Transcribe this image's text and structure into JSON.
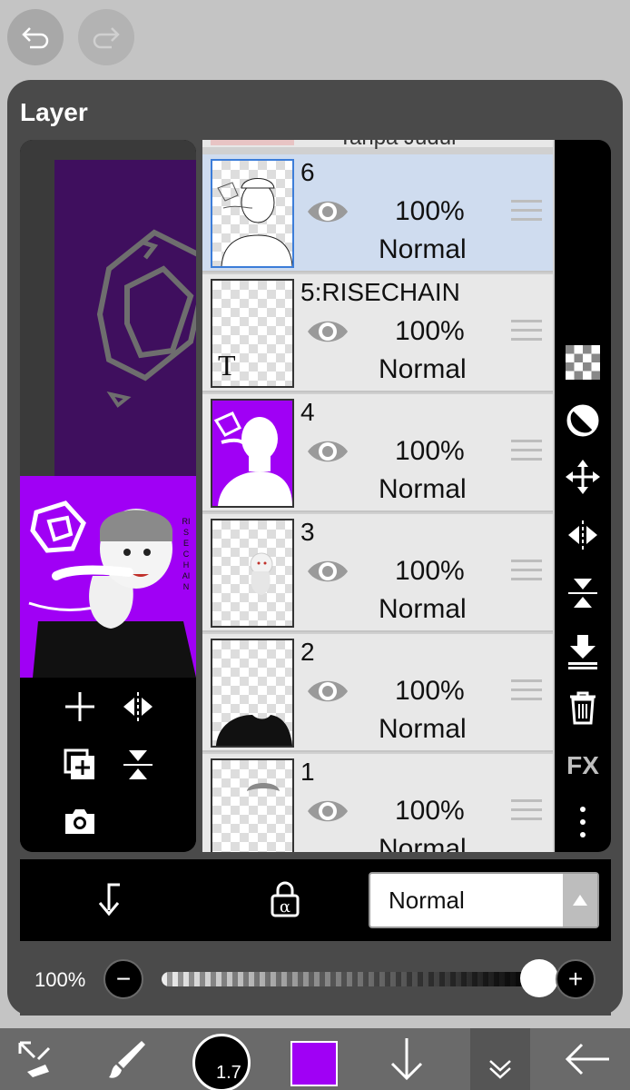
{
  "panel": {
    "title": "Layer"
  },
  "partial_layer_name": "Tanpa Judul",
  "layers": [
    {
      "name": "6",
      "opacity": "100%",
      "blend": "Normal",
      "selected": true
    },
    {
      "name": "5:RISECHAIN",
      "opacity": "100%",
      "blend": "Normal",
      "selected": false
    },
    {
      "name": "4",
      "opacity": "100%",
      "blend": "Normal",
      "selected": false
    },
    {
      "name": "3",
      "opacity": "100%",
      "blend": "Normal",
      "selected": false
    },
    {
      "name": "2",
      "opacity": "100%",
      "blend": "Normal",
      "selected": false
    },
    {
      "name": "1",
      "opacity": "100%",
      "blend": "Normal",
      "selected": false
    }
  ],
  "art_text": "RISECHAIN",
  "text_thumb_glyph": "T",
  "side_tools": [
    "checker-icon",
    "mask-icon",
    "move-icon",
    "flip-h-icon",
    "flip-v-icon",
    "merge-down-icon",
    "trash-icon",
    "fx-label",
    "more-icon"
  ],
  "fx_label": "FX",
  "blend_mode": {
    "value": "Normal"
  },
  "opacity_bar": {
    "label": "100%",
    "minus": "−",
    "plus": "+",
    "value": 1.0
  },
  "bottom": {
    "brush_size": "1.7",
    "color": "#a000f5"
  },
  "colors": {
    "accent": "#a000f5",
    "selected_row": "#cfdcef",
    "selected_border": "#3c7dd9"
  }
}
